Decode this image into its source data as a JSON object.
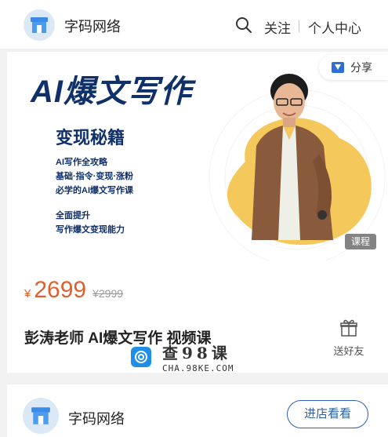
{
  "header": {
    "shop_name": "字码网络",
    "search_icon": "search-icon",
    "follow_label": "关注",
    "personal_center_label": "个人中心"
  },
  "banner": {
    "title": "AI爆文写作",
    "subtitle": "变现秘籍",
    "lines_group1": [
      "AI写作全攻略",
      "基础·指令·变现·涨粉",
      "必学的AI爆文写作课"
    ],
    "lines_group2": [
      "全面提升",
      "写作爆文变现能力"
    ],
    "share_label": "分享",
    "course_tag": "课程"
  },
  "product": {
    "currency": "¥",
    "price": "2699",
    "original_price": "¥2999",
    "name": "彭涛老师 AI爆文写作 视频课",
    "gift_label": "送好友"
  },
  "watermark": {
    "main": "查98课",
    "sub": "CHA.98KE.COM"
  },
  "shop": {
    "name": "字码网络",
    "enter_label": "进店看看"
  },
  "colors": {
    "accent": "#e0602d",
    "brand_blue": "#10306a",
    "button_blue": "#2f5faa",
    "blob_yellow": "#f5c85c"
  }
}
